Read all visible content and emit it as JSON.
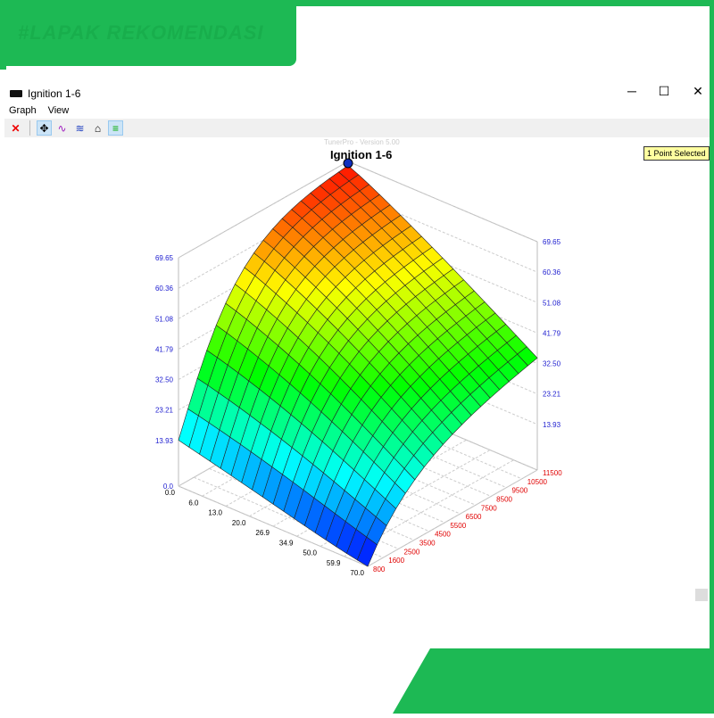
{
  "watermark": "#LAPAK REKOMENDASI",
  "window": {
    "title": "Ignition 1-6",
    "minimize": "─",
    "maximize": "☐",
    "close": "✕"
  },
  "menu": [
    "Graph",
    "View"
  ],
  "toolbar": {
    "close": "✕",
    "move": "✥",
    "trace": "∿",
    "trace2": "≋",
    "surface": "⌂",
    "colors": "≡"
  },
  "version_text": "TunerPro - Version 5.00",
  "badge": "1 Point Selected",
  "chart_data": {
    "type": "surface3d",
    "title": "Ignition 1-6",
    "x_label_ticks": [
      "0.0",
      "6.0",
      "13.0",
      "20.0",
      "26.9",
      "34.9",
      "50.0",
      "59.9",
      "70.0"
    ],
    "y_label_ticks": [
      "800",
      "1600",
      "2500",
      "3500",
      "4500",
      "5500",
      "6500",
      "7500",
      "8500",
      "9500",
      "10500",
      "11500"
    ],
    "z_ticks_left": [
      "0.0",
      "13.93",
      "23.21",
      "32.50",
      "41.79",
      "51.08",
      "60.36",
      "69.65"
    ],
    "z_ticks_right": [
      "13.93",
      "23.21",
      "32.50",
      "41.79",
      "51.08",
      "60.36",
      "69.65"
    ],
    "zlim": [
      0,
      69.65
    ],
    "colors": {
      "x_ticks": "#000000",
      "y_ticks": "#e00000",
      "z_ticks": "#2020d0"
    },
    "selected_point": {
      "load": "0.0",
      "rpm": "11500",
      "value": 69.65
    }
  }
}
